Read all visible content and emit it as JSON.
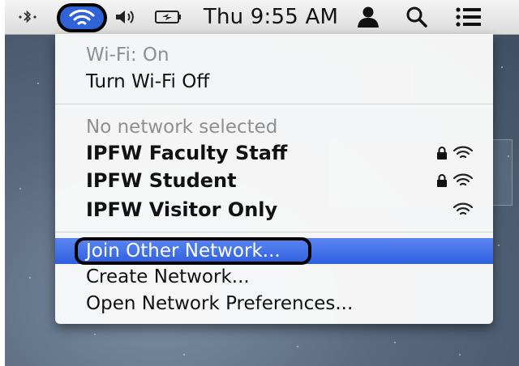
{
  "menubar": {
    "items": [
      {
        "icon": "bluetooth-icon"
      },
      {
        "icon": "wifi-icon",
        "active": true
      },
      {
        "icon": "volume-icon"
      },
      {
        "icon": "battery-icon"
      },
      {
        "icon": "user-icon"
      },
      {
        "icon": "spotlight-search-icon"
      },
      {
        "icon": "notification-list-icon"
      }
    ],
    "clock": "Thu 9:55 AM"
  },
  "wifi_menu": {
    "status": "Wi-Fi: On",
    "toggle": "Turn Wi-Fi Off",
    "no_network": "No network selected",
    "networks": [
      {
        "name": "IPFW Faculty Staff",
        "locked": true
      },
      {
        "name": "IPFW Student",
        "locked": true
      },
      {
        "name": "IPFW Visitor Only",
        "locked": false
      }
    ],
    "actions": [
      {
        "label": "Join Other Network...",
        "selected": true
      },
      {
        "label": "Create Network..."
      },
      {
        "label": "Open Network Preferences..."
      }
    ]
  },
  "colors": {
    "selection": "#2f5fe0",
    "wifi_active_bg": "#2f63d6"
  }
}
